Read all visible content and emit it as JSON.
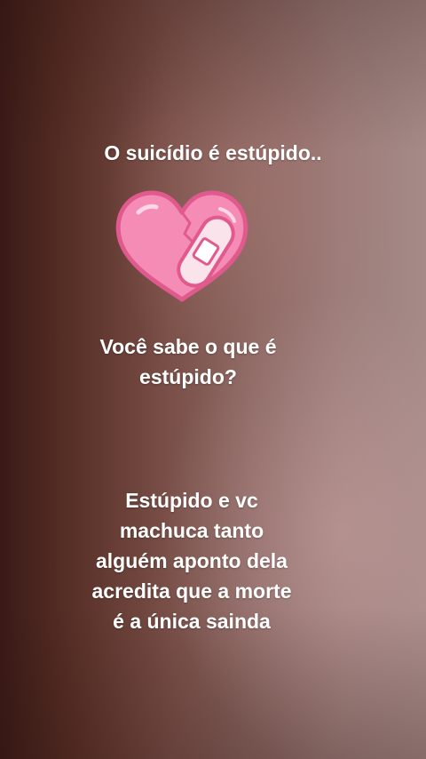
{
  "story": {
    "line1": "O suicídio é estúpido..",
    "question": [
      "Você sabe o que é",
      "estúpido?"
    ],
    "answer": [
      "Estúpido e vc",
      "machuca tanto",
      "alguém aponto dela",
      "acredita que a morte",
      "é a única sainda"
    ]
  },
  "colors": {
    "text": "#ffffff",
    "heart_fill": "#f48cb6",
    "heart_outline": "#e05a8e",
    "bandage": "#fbe3ec"
  },
  "icons": {
    "heart": "bandaged-broken-heart-icon"
  }
}
